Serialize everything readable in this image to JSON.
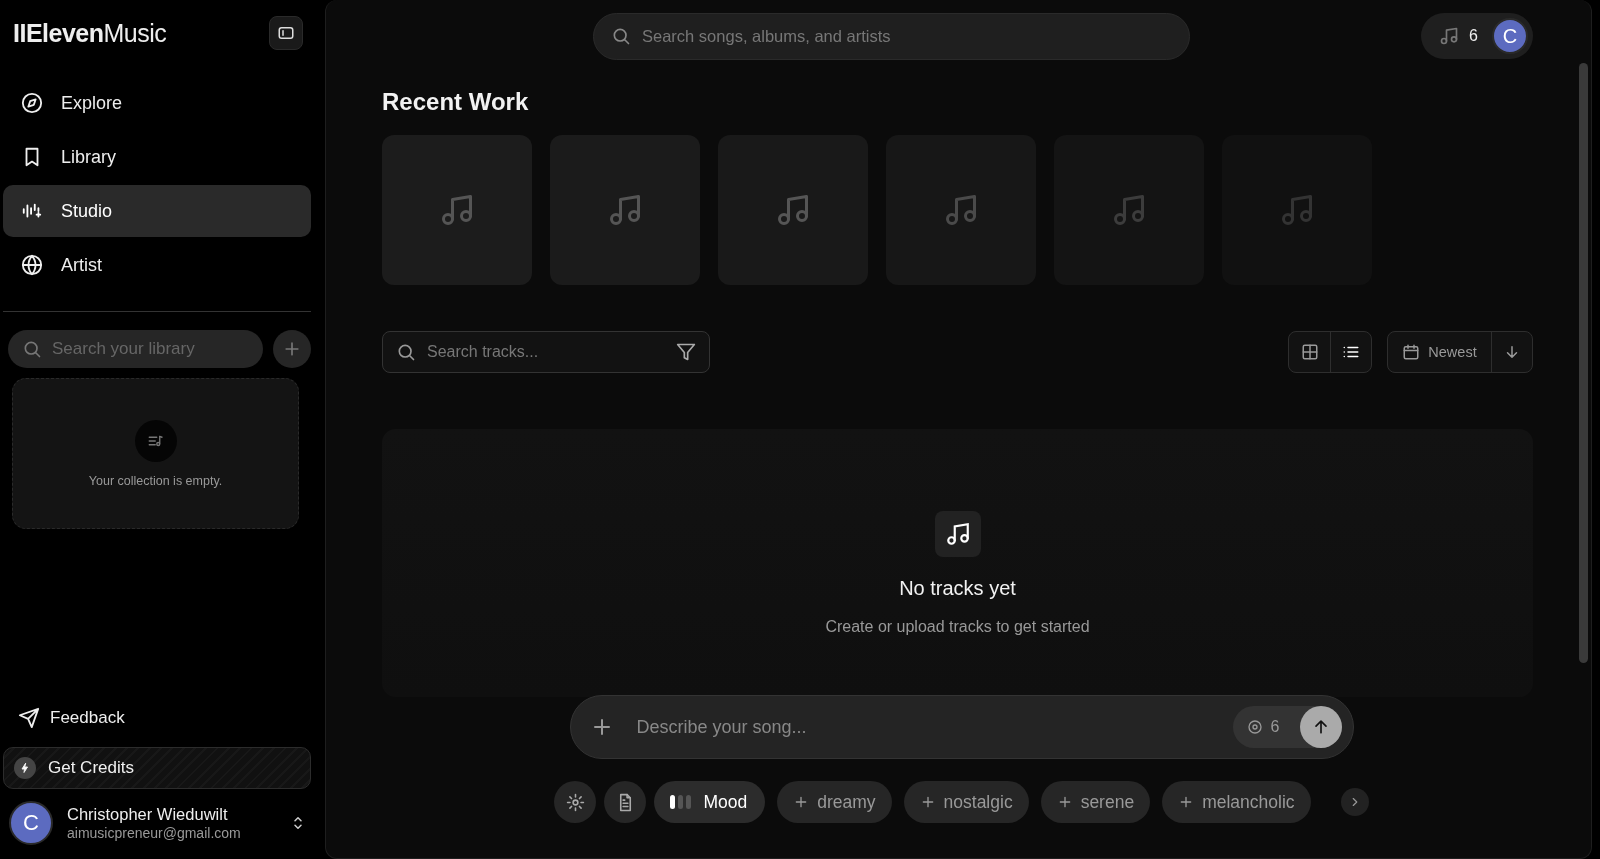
{
  "sidebar": {
    "logo": "**IIEleven**Music",
    "nav": [
      {
        "label": "Explore",
        "selected": false
      },
      {
        "label": "Library",
        "selected": false
      },
      {
        "label": "Studio",
        "selected": true
      },
      {
        "label": "Artist",
        "selected": false
      }
    ],
    "library_search": {
      "placeholder": "Search your library"
    },
    "collection": {
      "empty_text": "Your collection is empty."
    },
    "feedback": "Feedback",
    "get_credits": "Get Credits",
    "user": {
      "initial": "C",
      "name": "Christopher Wieduwilt",
      "email": "aimusicpreneur@gmail.com"
    }
  },
  "top_bar": {
    "search": {
      "placeholder": "Search songs, albums, and artists"
    },
    "credits": "6",
    "avatar": "C"
  },
  "recent_work": {
    "title": "Recent Work",
    "tiles": [
      {
        "kind": "placeholder"
      },
      {
        "kind": "placeholder"
      },
      {
        "kind": "placeholder"
      },
      {
        "kind": "placeholder"
      },
      {
        "kind": "placeholder"
      },
      {
        "kind": "placeholder"
      }
    ]
  },
  "toolbar": {
    "track_search": {
      "placeholder": "Search tracks..."
    },
    "views": [
      {
        "selected": false
      },
      {
        "selected": true
      }
    ],
    "sort": "Newest"
  },
  "empty_state": {
    "title": "No tracks yet",
    "text": "Create or upload tracks to get started"
  },
  "composer": {
    "placeholder": "Describe your song...",
    "cost": "6"
  },
  "chips": [
    {
      "kind": "settings"
    },
    {
      "kind": "lyrics"
    },
    {
      "kind": "mood",
      "label": "Mood"
    },
    {
      "kind": "tag",
      "label": "dreamy"
    },
    {
      "kind": "tag",
      "label": "nostalgic"
    },
    {
      "kind": "tag",
      "label": "serene"
    },
    {
      "kind": "tag",
      "label": "melancholic"
    }
  ]
}
